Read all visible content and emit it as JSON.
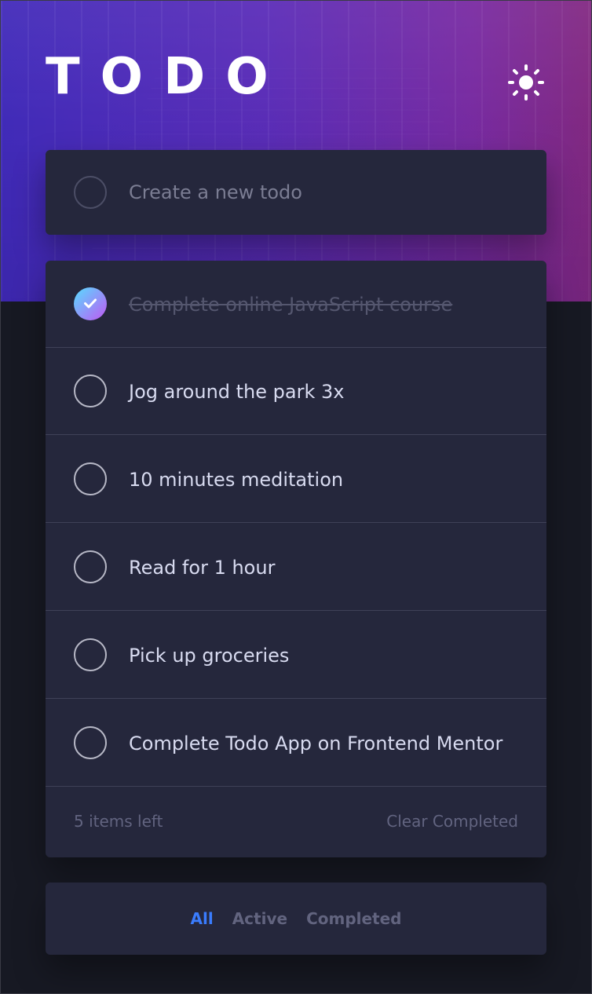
{
  "app": {
    "title": "TODO",
    "theme_toggle_icon": "sun-icon"
  },
  "new_todo": {
    "placeholder": "Create a new todo",
    "value": ""
  },
  "todos": [
    {
      "text": "Complete online JavaScript course",
      "completed": true
    },
    {
      "text": "Jog around the park 3x",
      "completed": false
    },
    {
      "text": "10 minutes meditation",
      "completed": false
    },
    {
      "text": "Read for 1 hour",
      "completed": false
    },
    {
      "text": "Pick up groceries",
      "completed": false
    },
    {
      "text": "Complete Todo App on Frontend Mentor",
      "completed": false
    }
  ],
  "footer": {
    "items_left": "5 items left",
    "clear_completed": "Clear Completed"
  },
  "filters": {
    "all": "All",
    "active": "Active",
    "completed": "Completed",
    "selected": "All"
  },
  "colors": {
    "accent": "#3a7cfd",
    "card": "#25273c",
    "background": "#171923",
    "check_gradient_start": "#57ddff",
    "check_gradient_end": "#c058f3"
  }
}
